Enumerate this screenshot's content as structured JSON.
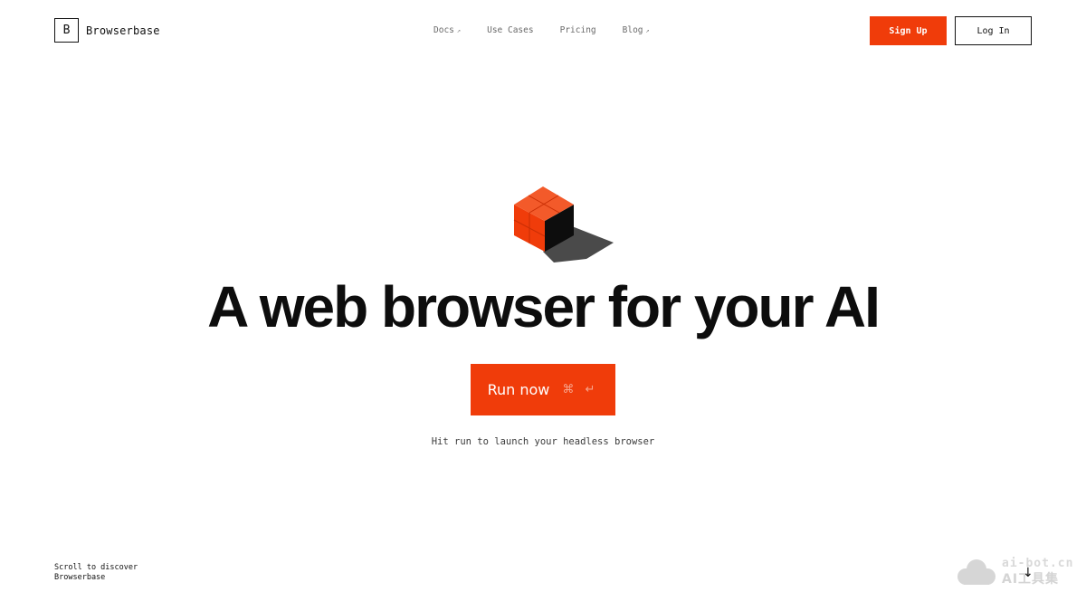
{
  "header": {
    "logo_letter": "B",
    "brand": "Browserbase",
    "nav": [
      {
        "label": "Docs",
        "external": true
      },
      {
        "label": "Use Cases",
        "external": false
      },
      {
        "label": "Pricing",
        "external": false
      },
      {
        "label": "Blog",
        "external": true
      }
    ],
    "signup_label": "Sign Up",
    "login_label": "Log In"
  },
  "hero": {
    "title": "A web browser for your AI",
    "run_label": "Run now",
    "run_shortcut": "⌘ ↵",
    "hint": "Hit run to launch your headless browser"
  },
  "footer": {
    "scroll_line1": "Scroll to discover",
    "scroll_line2": "Browserbase",
    "arrow": "↓"
  },
  "watermark": {
    "top": "ai-bot.cn",
    "bottom": "AI工具集"
  },
  "colors": {
    "accent": "#f03c0a",
    "text": "#111111",
    "muted": "#6a6a6a"
  },
  "icons": {
    "external": "external-link-icon",
    "arrow": "arrow-down-icon",
    "cube": "cube-icon"
  }
}
